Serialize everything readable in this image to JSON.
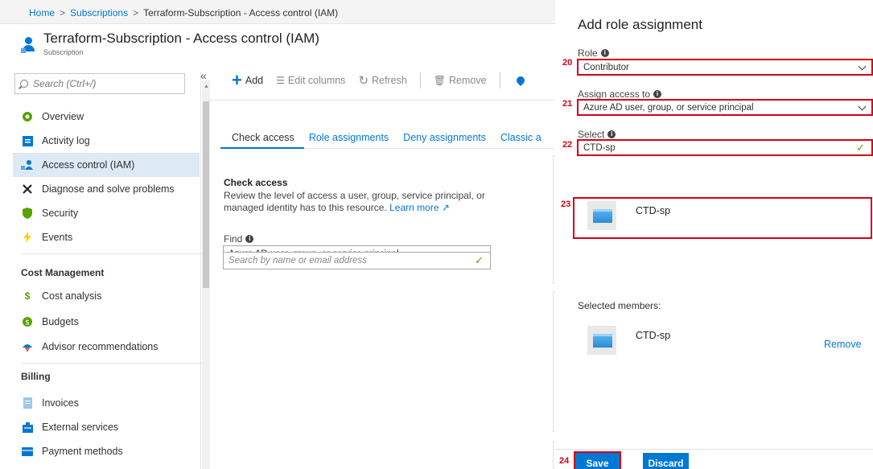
{
  "breadcrumb": {
    "home": "Home",
    "subscriptions": "Subscriptions",
    "current": "Terraform-Subscription - Access control (IAM)",
    "separator": ">"
  },
  "header": {
    "title_name": "Terraform-Subscription",
    "title_suffix": "- Access control (IAM)",
    "subtitle": "Subscription"
  },
  "sidebar": {
    "search_placeholder": "Search (Ctrl+/)",
    "collapse_glyph": "«",
    "items": [
      {
        "label": "Overview",
        "icon": "overview-icon"
      },
      {
        "label": "Activity log",
        "icon": "activity-log-icon"
      },
      {
        "label": "Access control (IAM)",
        "icon": "iam-icon",
        "active": true
      },
      {
        "label": "Diagnose and solve problems",
        "icon": "wrench-icon"
      },
      {
        "label": "Security",
        "icon": "shield-icon"
      },
      {
        "label": "Events",
        "icon": "lightning-icon"
      }
    ],
    "cost_heading": "Cost Management",
    "cost_items": [
      {
        "label": "Cost analysis",
        "icon": "cost-analysis-icon"
      },
      {
        "label": "Budgets",
        "icon": "budget-icon"
      },
      {
        "label": "Advisor recommendations",
        "icon": "advisor-icon"
      }
    ],
    "billing_heading": "Billing",
    "billing_items": [
      {
        "label": "Invoices",
        "icon": "invoice-icon"
      },
      {
        "label": "External services",
        "icon": "external-services-icon"
      },
      {
        "label": "Payment methods",
        "icon": "payment-icon"
      }
    ]
  },
  "toolbar": {
    "add": "Add",
    "edit_columns": "Edit columns",
    "refresh": "Refresh",
    "remove": "Remove"
  },
  "tabs": [
    "Check access",
    "Role assignments",
    "Deny assignments",
    "Classic a"
  ],
  "check_access": {
    "title": "Check access",
    "description": "Review the level of access a user, group, service principal, or managed identity has to this resource.",
    "learn_more": "Learn more",
    "find_label": "Find",
    "find_value": "Azure AD user, group, or service principal",
    "search_placeholder": "Search by name or email address"
  },
  "blade": {
    "title": "Add role assignment",
    "role_label": "Role",
    "role_value": "Contributor",
    "assign_label": "Assign access to",
    "assign_value": "Azure AD user, group, or service principal",
    "select_label": "Select",
    "select_value": "CTD-sp",
    "result_name": "CTD-sp",
    "selected_members_label": "Selected members:",
    "member_name": "CTD-sp",
    "remove_label": "Remove",
    "save_label": "Save",
    "discard_label": "Discard",
    "steps": {
      "role": "20",
      "assign": "21",
      "select": "22",
      "result": "23",
      "save": "24"
    }
  },
  "colors": {
    "accent": "#0078d4",
    "highlight": "#d4001a",
    "success": "#57a300"
  }
}
